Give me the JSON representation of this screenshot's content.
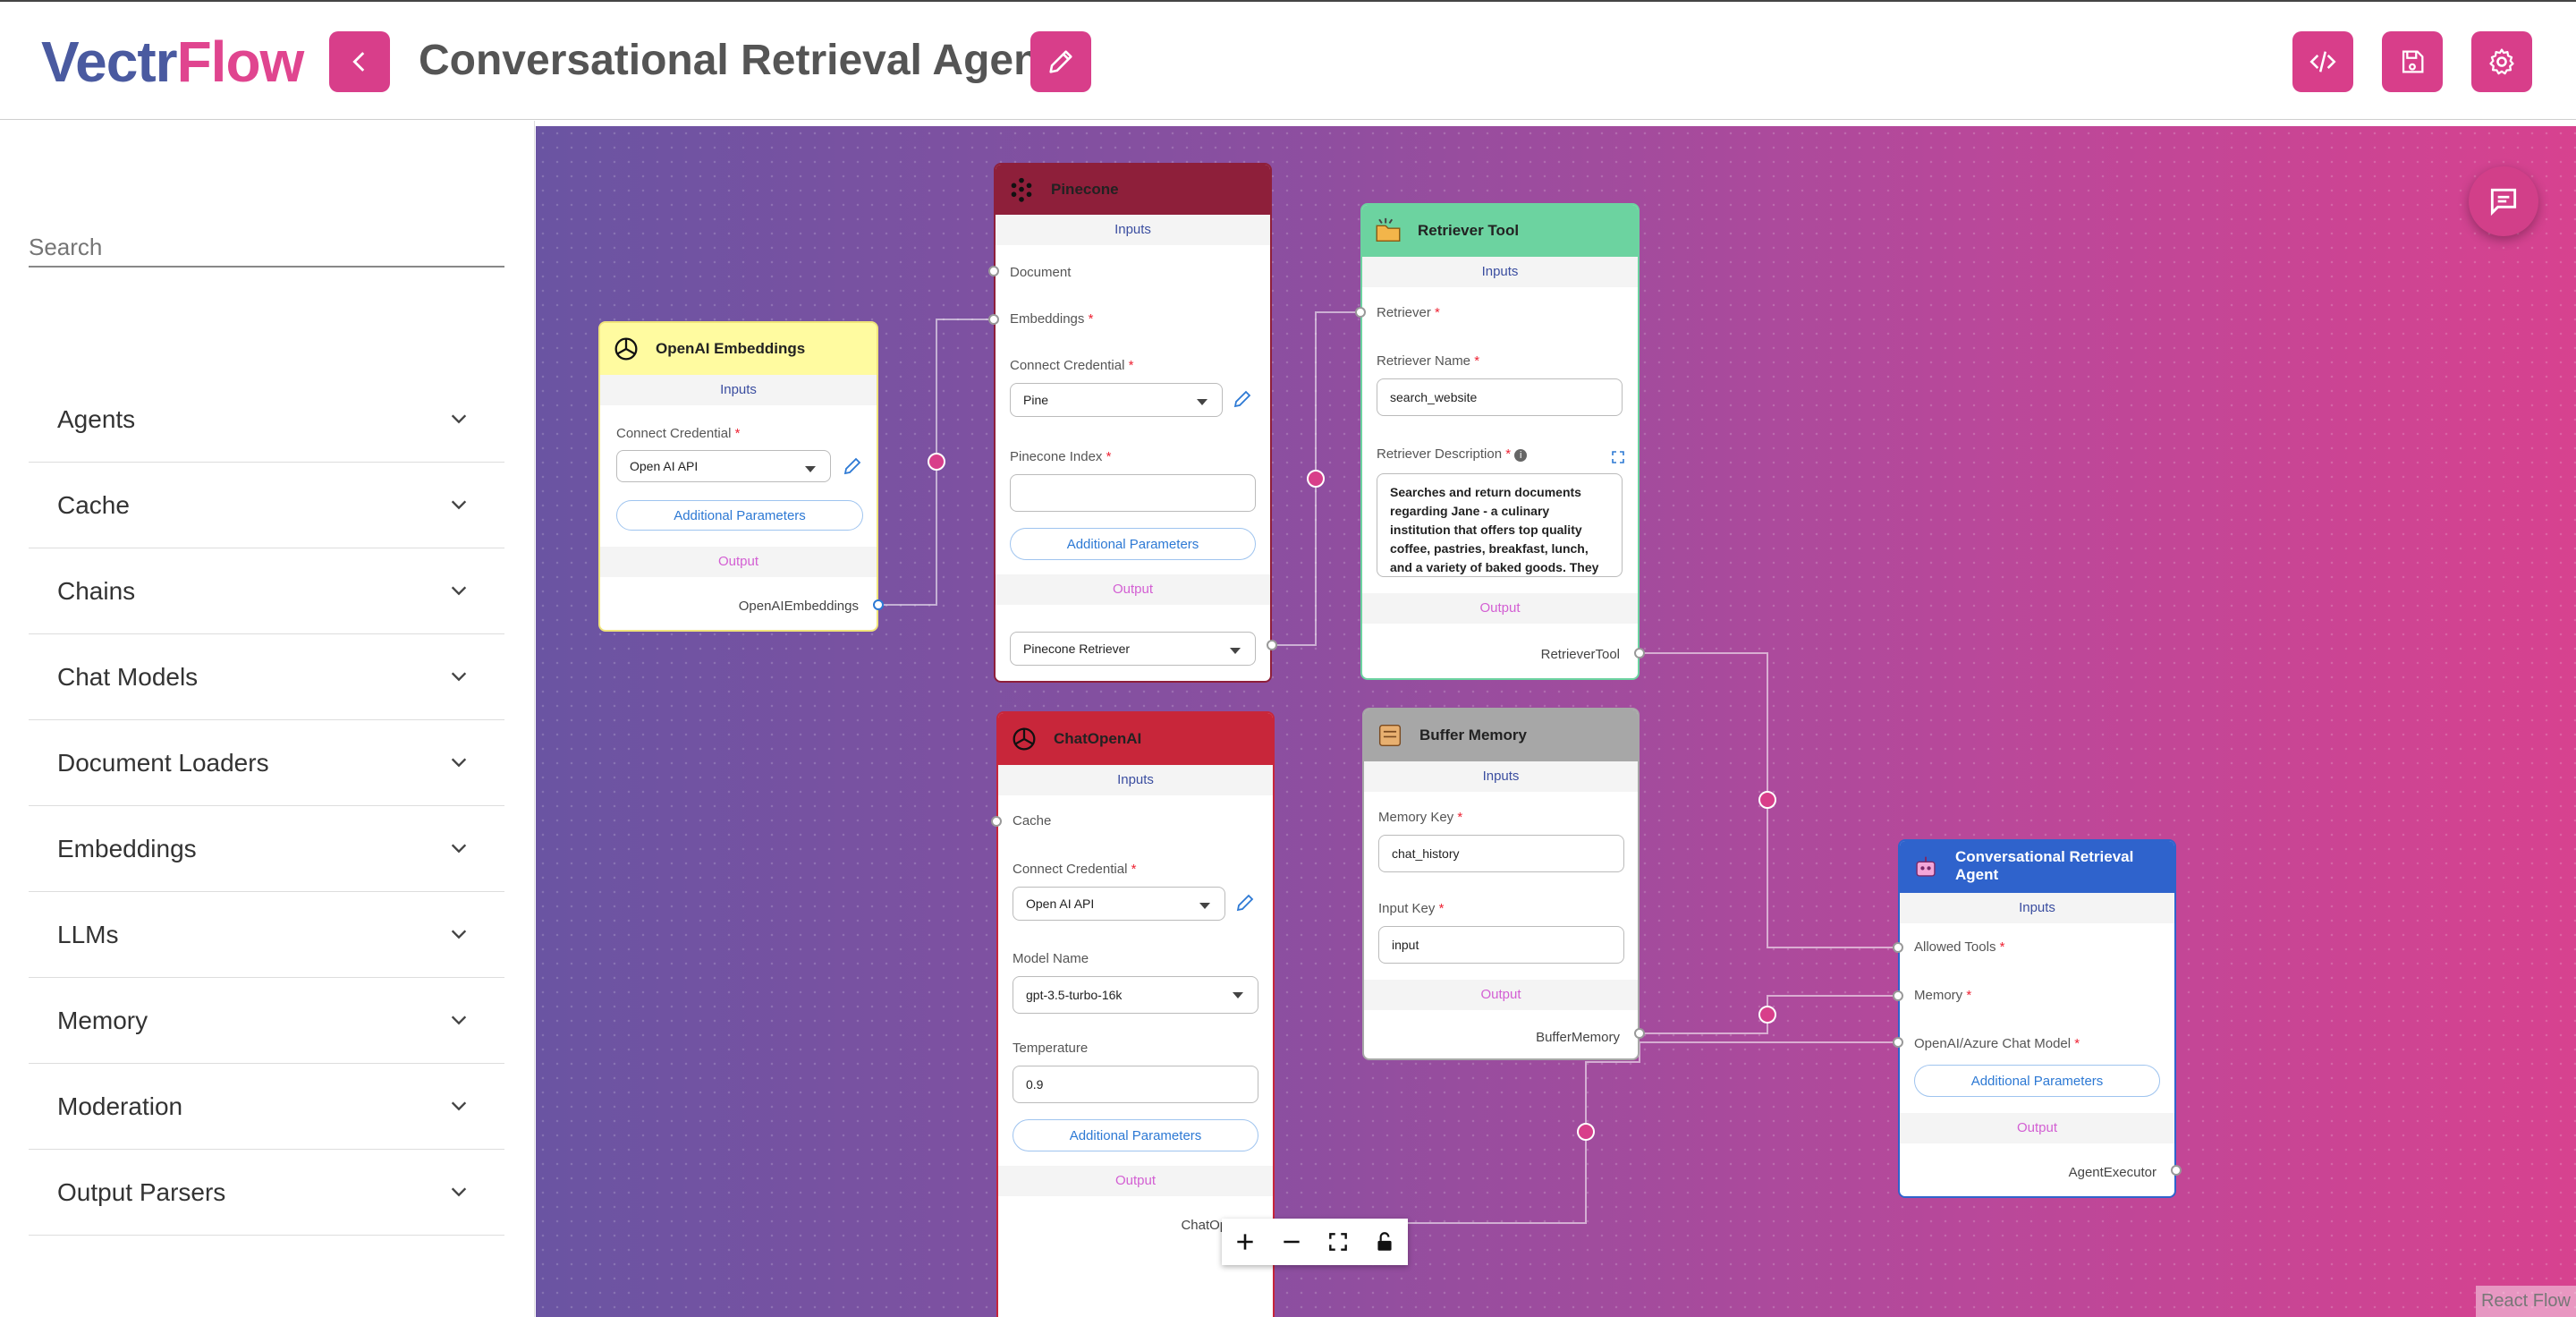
{
  "header": {
    "logo_a": "Vectr",
    "logo_b": "Flow",
    "title": "Conversational Retrieval Agent",
    "icons": [
      "back-icon",
      "edit-icon",
      "code-icon",
      "save-icon",
      "settings-icon"
    ]
  },
  "sidebar": {
    "search_placeholder": "Search",
    "categories": [
      "Agents",
      "Cache",
      "Chains",
      "Chat Models",
      "Document Loaders",
      "Embeddings",
      "LLMs",
      "Memory",
      "Moderation",
      "Output Parsers"
    ]
  },
  "nodes": {
    "embeddings": {
      "title": "OpenAI Embeddings",
      "inputs": "Inputs",
      "cred_label": "Connect Credential",
      "cred_value": "Open AI API",
      "addl": "Additional Parameters",
      "output": "Output",
      "out_label": "OpenAIEmbeddings"
    },
    "pinecone": {
      "title": "Pinecone",
      "inputs": "Inputs",
      "doc": "Document",
      "emb": "Embeddings",
      "cred_label": "Connect Credential",
      "cred_value": "Pine",
      "index_label": "Pinecone Index",
      "index_value": "",
      "addl": "Additional Parameters",
      "output": "Output",
      "out_value": "Pinecone Retriever"
    },
    "retriever": {
      "title": "Retriever Tool",
      "inputs": "Inputs",
      "retriever": "Retriever",
      "name_label": "Retriever Name",
      "name_value": "search_website",
      "desc_label": "Retriever Description",
      "desc_value": "Searches and return documents regarding Jane - a culinary institution that offers top quality coffee, pastries, breakfast, lunch, and a variety of baked goods. They",
      "output": "Output",
      "out_label": "RetrieverTool"
    },
    "chat": {
      "title": "ChatOpenAI",
      "inputs": "Inputs",
      "cache": "Cache",
      "cred_label": "Connect Credential",
      "cred_value": "Open AI API",
      "model_label": "Model Name",
      "model_value": "gpt-3.5-turbo-16k",
      "temp_label": "Temperature",
      "temp_value": "0.9",
      "addl": "Additional Parameters",
      "output": "Output",
      "out_label": "ChatOpenAI"
    },
    "memory": {
      "title": "Buffer Memory",
      "inputs": "Inputs",
      "key_label": "Memory Key",
      "key_value": "chat_history",
      "input_label": "Input Key",
      "input_value": "input",
      "output": "Output",
      "out_label": "BufferMemory"
    },
    "agent": {
      "title_1": "Conversational Retrieval",
      "title_2": "Agent",
      "inputs": "Inputs",
      "tools": "Allowed Tools",
      "memory": "Memory",
      "model": "OpenAI/Azure Chat Model",
      "addl": "Additional Parameters",
      "output": "Output",
      "out_label": "AgentExecutor"
    }
  },
  "colors": {
    "accent": "#d83e8a",
    "embeddings_header": "#fffba0",
    "pinecone_header": "#8e1f3a",
    "retriever_header": "#6cd3a0",
    "chat_header": "#c8263a",
    "memory_header": "#a7a7a7",
    "agent_header": "#2f63cc"
  },
  "attribution": "React Flow"
}
